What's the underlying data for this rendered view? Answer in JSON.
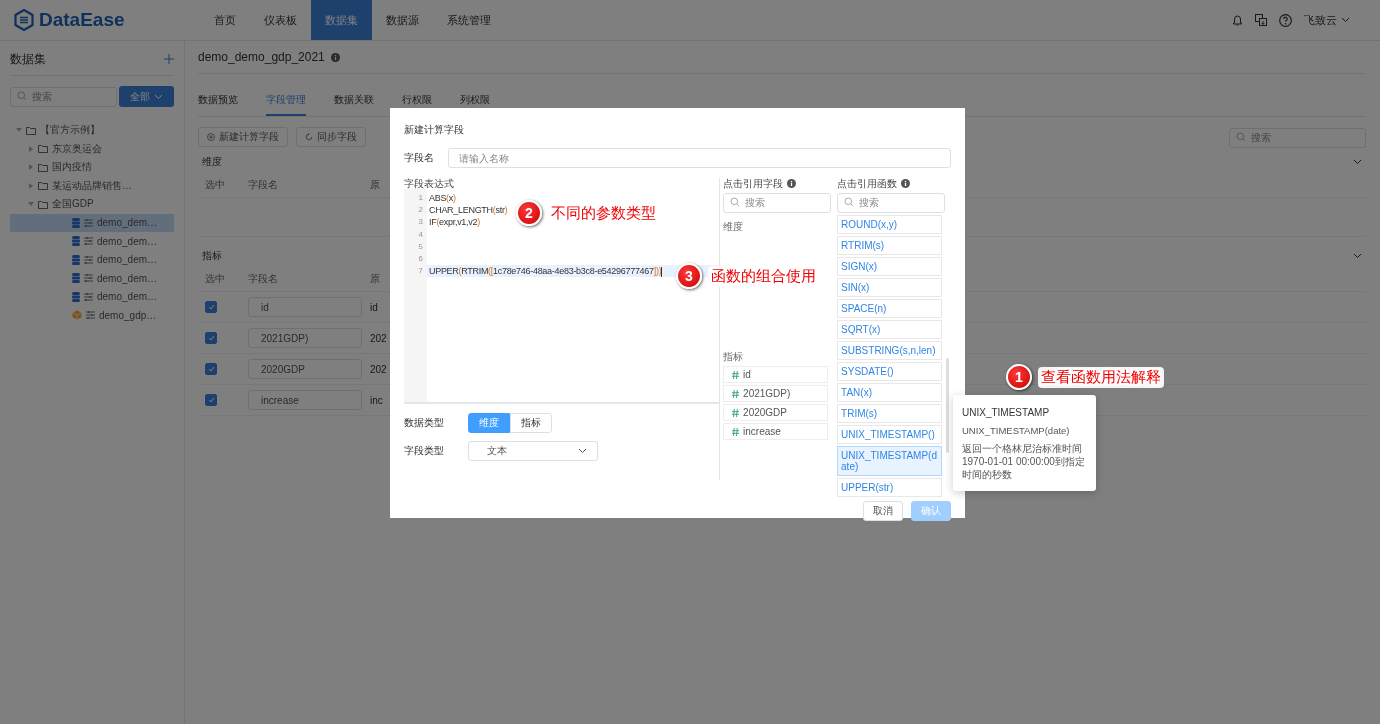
{
  "header": {
    "logo": "DataEase",
    "nav": [
      {
        "label": "首页",
        "selected": false
      },
      {
        "label": "仪表板",
        "selected": false
      },
      {
        "label": "数据集",
        "selected": true
      },
      {
        "label": "数据源",
        "selected": false
      },
      {
        "label": "系统管理",
        "selected": false
      }
    ],
    "user": "飞致云"
  },
  "sidebar": {
    "title": "数据集",
    "search_placeholder": "搜索",
    "filter_button": "全部",
    "tree": [
      {
        "label": "【官方示例】",
        "expanded": true,
        "children": [
          {
            "label": "东京奥运会",
            "expanded": false
          },
          {
            "label": "国内疫情",
            "expanded": false
          },
          {
            "label": "某运动品牌销售…",
            "expanded": false
          },
          {
            "label": "全国GDP",
            "expanded": true,
            "children": [
              {
                "label": "demo_dem…",
                "kind": "db",
                "selected": true
              },
              {
                "label": "demo_dem…",
                "kind": "db",
                "selected": false
              },
              {
                "label": "demo_dem…",
                "kind": "db",
                "selected": false
              },
              {
                "label": "demo_dem…",
                "kind": "db",
                "selected": false
              },
              {
                "label": "demo_dem…",
                "kind": "db",
                "selected": false
              },
              {
                "label": "demo_gdp…",
                "kind": "excel",
                "selected": false
              }
            ]
          }
        ]
      }
    ]
  },
  "dataset": {
    "title": "demo_demo_gdp_2021",
    "tabs": [
      {
        "label": "数据预览",
        "selected": false
      },
      {
        "label": "字段管理",
        "selected": true
      },
      {
        "label": "数据关联",
        "selected": false
      },
      {
        "label": "行权限",
        "selected": false
      },
      {
        "label": "列权限",
        "selected": false
      }
    ],
    "actions": [
      {
        "label": "新建计算字段",
        "kind": "add"
      },
      {
        "label": "同步字段",
        "kind": "sync"
      }
    ],
    "search_placeholder": "搜索",
    "dimension": {
      "title": "维度",
      "columns": [
        "选中",
        "字段名",
        "原"
      ]
    },
    "measure": {
      "title": "指标",
      "columns": [
        "选中",
        "字段名",
        "原"
      ],
      "rows": [
        {
          "checked": true,
          "name": "id",
          "column_3": "id"
        },
        {
          "checked": true,
          "name": "2021GDP)",
          "column_3": "202"
        },
        {
          "checked": true,
          "name": "2020GDP",
          "column_3": "202"
        },
        {
          "checked": true,
          "name": "increase",
          "column_3": "inc"
        }
      ]
    }
  },
  "dialog": {
    "title": "新建计算字段",
    "name_label": "字段名",
    "name_placeholder": "请输入名称",
    "expression_label": "字段表达式",
    "code_lines": [
      {
        "number": "1",
        "code": "ABS(x)",
        "active": false
      },
      {
        "number": "2",
        "code": "CHAR_LENGTH(str)",
        "active": false
      },
      {
        "number": "3",
        "code": "IF(expr,v1,v2)",
        "active": false
      },
      {
        "number": "4",
        "active": false
      },
      {
        "number": "5",
        "active": false
      },
      {
        "number": "6",
        "active": false
      },
      {
        "number": "7",
        "code": "UPPER(RTRIM([1c78e746-48aa-4e83-b3c8-e54296777467]))",
        "active": true
      }
    ],
    "data_type": {
      "label": "数据类型",
      "options": [
        {
          "label": "维度",
          "selected": true
        },
        {
          "label": "指标",
          "selected": false
        }
      ]
    },
    "field_type": {
      "label": "字段类型",
      "value": "文本"
    },
    "field_panel": {
      "title": "点击引用字段",
      "search_placeholder": "搜索",
      "dimension_label": "维度",
      "measure_label": "指标",
      "measures": [
        "id",
        "2021GDP)",
        "2020GDP",
        "increase"
      ]
    },
    "function_panel": {
      "title": "点击引用函数",
      "search_placeholder": "搜索",
      "functions": [
        {
          "label": "ROUND(x,y)",
          "selected": false
        },
        {
          "label": "RTRIM(s)",
          "selected": false
        },
        {
          "label": "SIGN(x)",
          "selected": false
        },
        {
          "label": "SIN(x)",
          "selected": false
        },
        {
          "label": "SPACE(n)",
          "selected": false
        },
        {
          "label": "SQRT(x)",
          "selected": false
        },
        {
          "label": "SUBSTRING(s,n,len)",
          "selected": false
        },
        {
          "label": "SYSDATE()",
          "selected": false
        },
        {
          "label": "TAN(x)",
          "selected": false
        },
        {
          "label": "TRIM(s)",
          "selected": false
        },
        {
          "label": "UNIX_TIMESTAMP()",
          "selected": false
        },
        {
          "label": "UNIX_TIMESTAMP(date)",
          "selected": true
        },
        {
          "label": "UPPER(str)",
          "selected": false
        }
      ]
    },
    "buttons": [
      {
        "label": "取消",
        "kind": "default",
        "disabled": false
      },
      {
        "label": "确认",
        "kind": "primary",
        "disabled": true
      }
    ]
  },
  "tooltip": {
    "title": "UNIX_TIMESTAMP",
    "signature": "UNIX_TIMESTAMP(date)",
    "description": "返回一个格林尼治标准时间1970-01-01 00:00:00到指定时间的秒数"
  },
  "annotations": [
    {
      "number": "2",
      "text": "不同的参数类型"
    },
    {
      "number": "3",
      "text": "函数的组合使用"
    },
    {
      "number": "1",
      "text": "查看函数用法解释"
    }
  ]
}
